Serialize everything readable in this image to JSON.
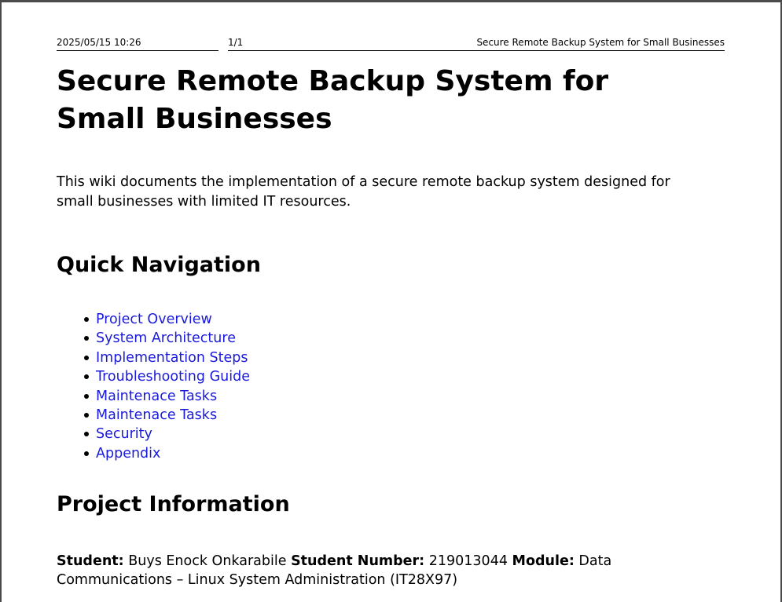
{
  "print_header": {
    "date": "2025/05/15 10:26",
    "page": "1/1",
    "title": "Secure Remote Backup System for Small Businesses"
  },
  "document": {
    "title": "Secure Remote Backup System for Small Businesses",
    "intro": "This wiki documents the implementation of a secure remote backup system designed for small businesses with limited IT resources."
  },
  "quick_navigation": {
    "heading": "Quick Navigation",
    "links": [
      {
        "label": "Project Overview"
      },
      {
        "label": "System Architecture"
      },
      {
        "label": "Implementation Steps"
      },
      {
        "label": "Troubleshooting Guide"
      },
      {
        "label": "Maintenace Tasks"
      },
      {
        "label": "Maintenace Tasks"
      },
      {
        "label": "Security"
      },
      {
        "label": "Appendix"
      }
    ],
    "bullet_icon": "bullet-dot-icon",
    "link_color": "#1a1adc"
  },
  "project_information": {
    "heading": "Project Information",
    "student_label": "Student:",
    "student_value": "Buys Enock Onkarabile",
    "student_number_label": "Student Number:",
    "student_number_value": "219013044",
    "module_label": "Module:",
    "module_value": "Data Communications – Linux System Administration (IT28X97)"
  }
}
